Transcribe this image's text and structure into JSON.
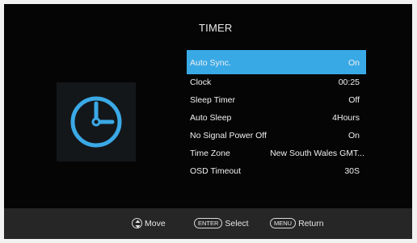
{
  "menu": {
    "title": "TIMER",
    "items": [
      {
        "label": "Auto Sync.",
        "value": "On"
      },
      {
        "label": "Clock",
        "value": "00:25"
      },
      {
        "label": "Sleep Timer",
        "value": "Off"
      },
      {
        "label": "Auto Sleep",
        "value": "4Hours"
      },
      {
        "label": "No Signal Power Off",
        "value": "On"
      },
      {
        "label": "Time Zone",
        "value": "New South Wales GMT..."
      },
      {
        "label": "OSD Timeout",
        "value": "30S"
      }
    ]
  },
  "icon": {
    "name": "clock-icon",
    "color": "#3aa9e6"
  },
  "colors": {
    "accent": "#39a9e6",
    "background": "#050505",
    "footer": "#262626"
  },
  "footer": {
    "move_label": "Move",
    "enter_key": "ENTER",
    "enter_label": "Select",
    "menu_key": "MENU",
    "menu_label": "Return"
  }
}
